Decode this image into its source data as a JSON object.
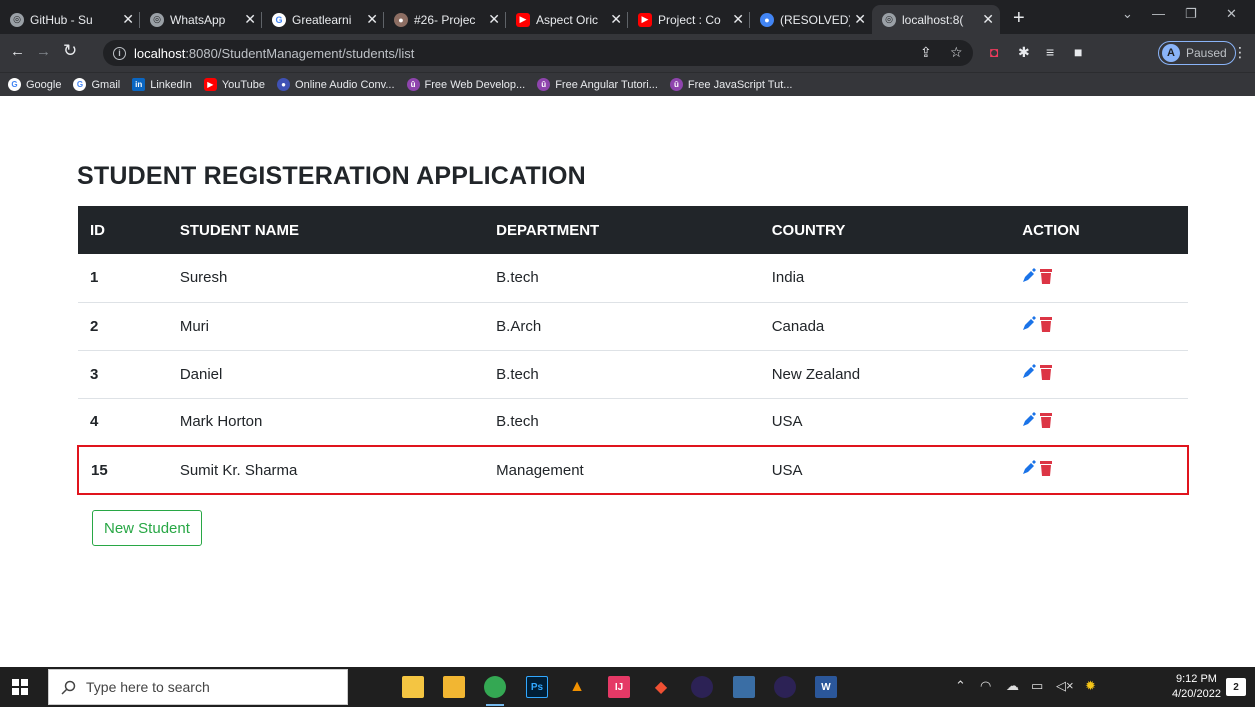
{
  "browser": {
    "tabs": [
      {
        "label": "GitHub - Su",
        "icon": "globe-icon",
        "color": "#9aa0a6"
      },
      {
        "label": "WhatsApp",
        "icon": "globe-icon",
        "color": "#9aa0a6"
      },
      {
        "label": "Greatlearni",
        "icon": "google-icon",
        "color": "#ffffff"
      },
      {
        "label": "#26- Projec",
        "icon": "avatar-icon",
        "color": "#8d6e63"
      },
      {
        "label": "Aspect Oric",
        "icon": "youtube-icon",
        "color": "#ff0000"
      },
      {
        "label": "Project : Co",
        "icon": "youtube-icon",
        "color": "#ff0000"
      },
      {
        "label": "(RESOLVED)",
        "icon": "circle-icon",
        "color": "#4285f4"
      },
      {
        "label": "localhost:8(",
        "icon": "globe-icon",
        "color": "#9aa0a6",
        "active": true
      }
    ],
    "new_tab": "+",
    "address": {
      "host": "localhost",
      "rest": ":8080/StudentManagement/students/list"
    },
    "profile": {
      "initial": "A",
      "status": "Paused"
    },
    "bookmarks": [
      {
        "label": "Google",
        "icon": "google-icon",
        "color": "#4285f4"
      },
      {
        "label": "Gmail",
        "icon": "google-icon",
        "color": "#4285f4"
      },
      {
        "label": "LinkedIn",
        "icon": "linkedin-icon",
        "color": "#0a66c2"
      },
      {
        "label": "YouTube",
        "icon": "youtube-icon",
        "color": "#ff0000"
      },
      {
        "label": "Online Audio Conv...",
        "icon": "audio-icon",
        "color": "#3f51b5"
      },
      {
        "label": "Free Web Develop...",
        "icon": "udemy-icon",
        "color": "#8e44ad"
      },
      {
        "label": "Free Angular Tutori...",
        "icon": "udemy-icon",
        "color": "#8e44ad"
      },
      {
        "label": "Free JavaScript Tut...",
        "icon": "udemy-icon",
        "color": "#8e44ad"
      }
    ]
  },
  "page": {
    "title": "STUDENT REGISTERATION APPLICATION",
    "table": {
      "headers": [
        "ID",
        "STUDENT NAME",
        "DEPARTMENT",
        "COUNTRY",
        "ACTION"
      ],
      "rows": [
        {
          "id": "1",
          "name": "Suresh",
          "department": "B.tech",
          "country": "India"
        },
        {
          "id": "2",
          "name": "Muri",
          "department": "B.Arch",
          "country": "Canada"
        },
        {
          "id": "3",
          "name": "Daniel",
          "department": "B.tech",
          "country": "New Zealand"
        },
        {
          "id": "4",
          "name": "Mark Horton",
          "department": "B.tech",
          "country": "USA"
        },
        {
          "id": "15",
          "name": "Sumit Kr. Sharma",
          "department": "Management",
          "country": "USA",
          "highlighted": true
        }
      ]
    },
    "new_button": "New Student",
    "colors": {
      "header_bg": "#212529",
      "edit": "#1a73e8",
      "delete": "#dc3545",
      "highlight": "#e0141d",
      "button": "#28a745"
    }
  },
  "taskbar": {
    "search_placeholder": "Type here to search",
    "time": "9:12 PM",
    "date": "4/20/2022",
    "notifications": "2"
  }
}
